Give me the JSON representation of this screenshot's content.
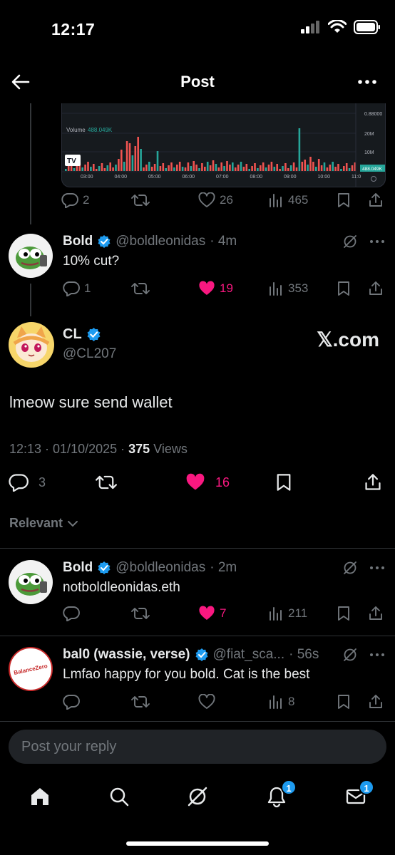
{
  "status_bar": {
    "time": "12:17"
  },
  "header": {
    "title": "Post"
  },
  "chart_snippet": {
    "volume_label": "Volume",
    "volume_value": "488.049K",
    "y_ticks": [
      "0.88000",
      "20M",
      "10M"
    ],
    "current_tag": "488.049K",
    "x_ticks": [
      "03:00",
      "04:00",
      "05:00",
      "06:00",
      "07:00",
      "08:00",
      "09:00",
      "10:00",
      "11:0"
    ],
    "logo": "TV"
  },
  "tweet_prev": {
    "replies": "2",
    "retweets": "",
    "likes": "26",
    "views": "465"
  },
  "reply_bold": {
    "name": "Bold",
    "handle": "@boldleonidas",
    "time": "· 4m",
    "text": "10% cut?",
    "replies": "1",
    "likes": "19",
    "views": "353"
  },
  "main_post": {
    "name": "CL",
    "handle": "@CL207",
    "watermark": "𝕏.com",
    "text": "lmeow sure send wallet",
    "timestamp": "12:13 · 01/10/2025 · ",
    "views_count": "375",
    "views_label": " Views",
    "replies": "3",
    "likes": "16"
  },
  "sort": {
    "label": "Relevant"
  },
  "replies": [
    {
      "name": "Bold",
      "handle": "@boldleonidas",
      "time": "· 2m",
      "text": "notboldleonidas.eth",
      "likes": "7",
      "views": "211"
    },
    {
      "name": "bal0 (wassie, verse)",
      "handle": "@fiat_sca...",
      "time": "· 56s",
      "text": "Lmfao happy for you bold. Cat  is the best",
      "likes": "",
      "views": "8",
      "avatar_text": "BalanceZero"
    }
  ],
  "composer": {
    "placeholder": "Post your reply"
  },
  "tabbar": {
    "notifications_badge": "1",
    "messages_badge": "1"
  },
  "colors": {
    "accent": "#1d9bf0",
    "like": "#f91880",
    "muted": "#71767b",
    "up": "#26a69a",
    "down": "#ef5350"
  }
}
